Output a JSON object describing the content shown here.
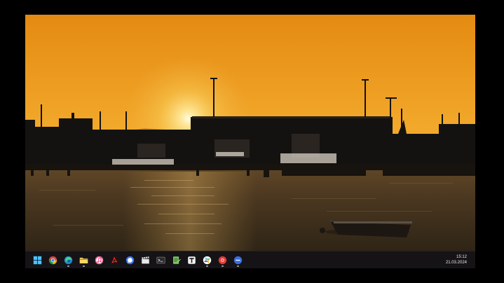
{
  "desktop": {
    "wallpaper": {
      "sky_top": "#ef9a1c",
      "sky_horizon": "#f7c24a",
      "sun": "#fff3b0",
      "water": "#3a2a18",
      "silhouette": "#141210"
    }
  },
  "taskbar": {
    "apps": [
      {
        "name": "start-button",
        "icon": "windows-logo-icon",
        "running": false
      },
      {
        "name": "chrome-taskbar-button",
        "icon": "chrome-icon",
        "running": false
      },
      {
        "name": "edge-taskbar-button",
        "icon": "edge-icon",
        "running": true
      },
      {
        "name": "file-explorer-taskbar-button",
        "icon": "folder-icon",
        "running": true
      },
      {
        "name": "itunes-taskbar-button",
        "icon": "music-note-icon",
        "running": false
      },
      {
        "name": "acrobat-taskbar-button",
        "icon": "acrobat-icon",
        "running": false
      },
      {
        "name": "signal-taskbar-button",
        "icon": "chat-bubble-icon",
        "running": false
      },
      {
        "name": "video-editor-taskbar-button",
        "icon": "clapperboard-icon",
        "running": false
      },
      {
        "name": "terminal-taskbar-button",
        "icon": "terminal-icon",
        "running": false
      },
      {
        "name": "notepad-taskbar-button",
        "icon": "notepad-icon",
        "running": false
      },
      {
        "name": "typora-taskbar-button",
        "icon": "letter-t-icon",
        "running": false
      },
      {
        "name": "slack-taskbar-button",
        "icon": "slack-icon",
        "running": true
      },
      {
        "name": "screen-recorder-taskbar-button",
        "icon": "record-icon",
        "running": true
      },
      {
        "name": "more-apps-taskbar-button",
        "icon": "more-dots-icon",
        "running": true
      }
    ],
    "clock": {
      "time": "15:12",
      "date": "21.03.2024"
    }
  }
}
